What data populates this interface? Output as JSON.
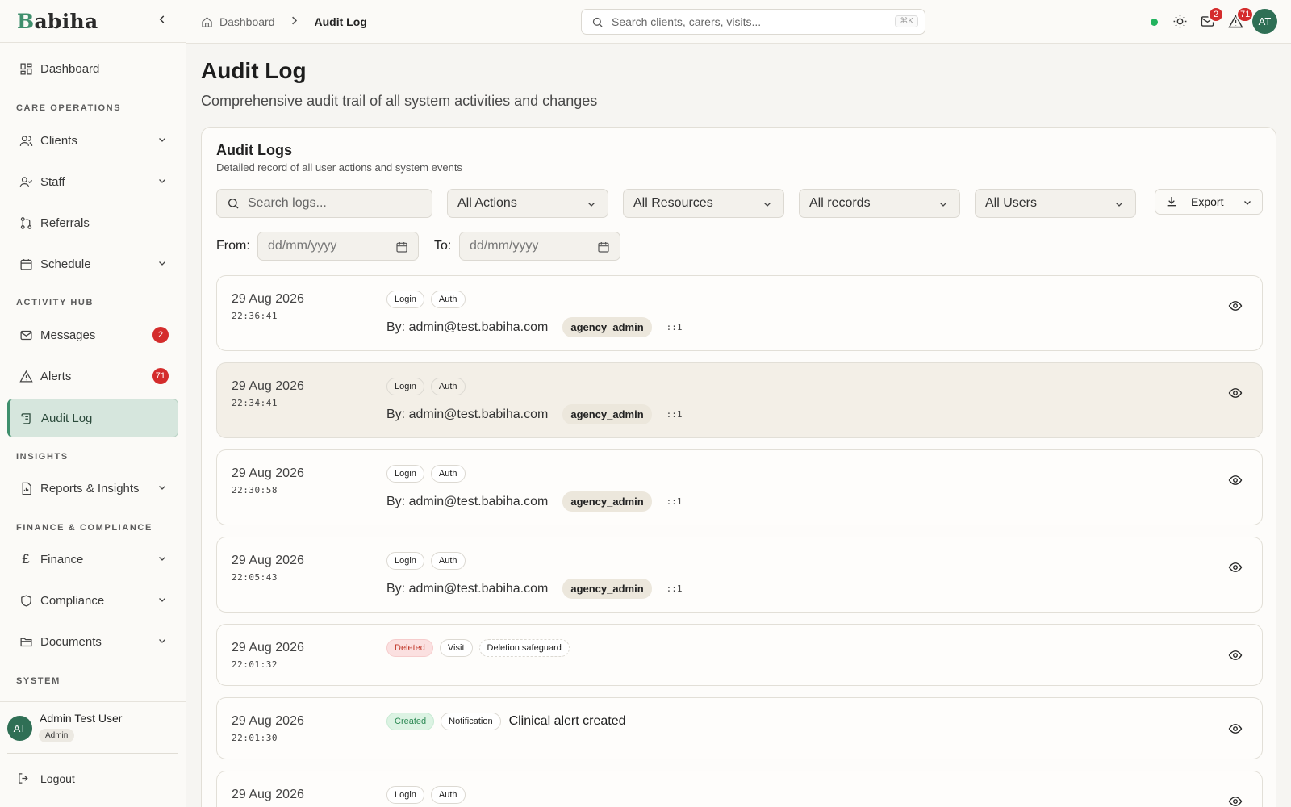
{
  "brand": {
    "logo_first": "B",
    "logo_rest": "abiha"
  },
  "sidebar": {
    "dashboard": "Dashboard",
    "sections": {
      "care": "CARE OPERATIONS",
      "activity": "ACTIVITY HUB",
      "insights": "INSIGHTS",
      "finance": "FINANCE & COMPLIANCE",
      "system": "SYSTEM"
    },
    "items": {
      "clients": "Clients",
      "staff": "Staff",
      "referrals": "Referrals",
      "schedule": "Schedule",
      "messages": "Messages",
      "messages_badge": "2",
      "alerts": "Alerts",
      "alerts_badge": "71",
      "audit": "Audit Log",
      "reports": "Reports & Insights",
      "finance": "Finance",
      "compliance": "Compliance",
      "documents": "Documents"
    },
    "user": {
      "initials": "AT",
      "name": "Admin Test User",
      "role": "Admin"
    },
    "logout": "Logout"
  },
  "topbar": {
    "breadcrumb_home": "Dashboard",
    "breadcrumb_current": "Audit Log",
    "search_placeholder": "Search clients, carers, visits...",
    "shortcut": "⌘K",
    "messages_badge": "2",
    "alerts_badge": "71",
    "avatar": "AT"
  },
  "page": {
    "title": "Audit Log",
    "subtitle": "Comprehensive audit trail of all system activities and changes"
  },
  "card": {
    "title": "Audit Logs",
    "subtitle": "Detailed record of all user actions and system events",
    "search_placeholder": "Search logs...",
    "filters": {
      "actions": "All Actions",
      "resources": "All Resources",
      "records": "All records",
      "users": "All Users"
    },
    "export": "Export",
    "from_label": "From:",
    "to_label": "To:",
    "date_placeholder": "dd/mm/yyyy"
  },
  "logs": [
    {
      "date": "29 Aug 2026",
      "time": "22:36:41",
      "action": "Login",
      "resource": "Auth",
      "by": "By: admin@test.babiha.com",
      "role": "agency_admin",
      "ip": "::1"
    },
    {
      "date": "29 Aug 2026",
      "time": "22:34:41",
      "action": "Login",
      "resource": "Auth",
      "by": "By: admin@test.babiha.com",
      "role": "agency_admin",
      "ip": "::1"
    },
    {
      "date": "29 Aug 2026",
      "time": "22:30:58",
      "action": "Login",
      "resource": "Auth",
      "by": "By: admin@test.babiha.com",
      "role": "agency_admin",
      "ip": "::1"
    },
    {
      "date": "29 Aug 2026",
      "time": "22:05:43",
      "action": "Login",
      "resource": "Auth",
      "by": "By: admin@test.babiha.com",
      "role": "agency_admin",
      "ip": "::1"
    },
    {
      "date": "29 Aug 2026",
      "time": "22:01:32",
      "action": "Deleted",
      "resource": "Visit",
      "extra": "Deletion safeguard"
    },
    {
      "date": "29 Aug 2026",
      "time": "22:01:30",
      "action": "Created",
      "resource": "Notification",
      "description": "Clinical alert created"
    },
    {
      "date": "29 Aug 2026",
      "action": "Login",
      "resource": "Auth"
    }
  ],
  "colors": {
    "accent": "#3f8f6d",
    "badge": "#d42c2c",
    "status": "#22b35e"
  }
}
